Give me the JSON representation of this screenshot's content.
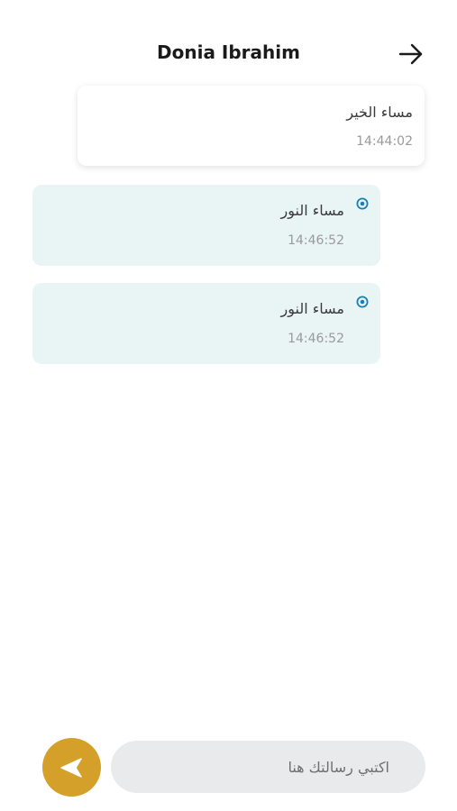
{
  "header": {
    "title": "Donia Ibrahim",
    "back_icon": "arrow-right-icon"
  },
  "messages": [
    {
      "direction": "sent",
      "text": "مساء الخير",
      "time": "14:44:02"
    },
    {
      "direction": "received",
      "text": "مساء النور",
      "time": "14:46:52",
      "status_icon": "read-indicator-icon"
    },
    {
      "direction": "received",
      "text": "مساء النور",
      "time": "14:46:52",
      "status_icon": "read-indicator-icon"
    }
  ],
  "composer": {
    "placeholder": "اكتبي رسالتك هنا",
    "send_icon": "send-icon"
  },
  "colors": {
    "accent": "#d4a02a",
    "received_bubble": "#e9f5f4",
    "input_background": "#e9eaec",
    "status_icon": "#1a7fb5"
  }
}
